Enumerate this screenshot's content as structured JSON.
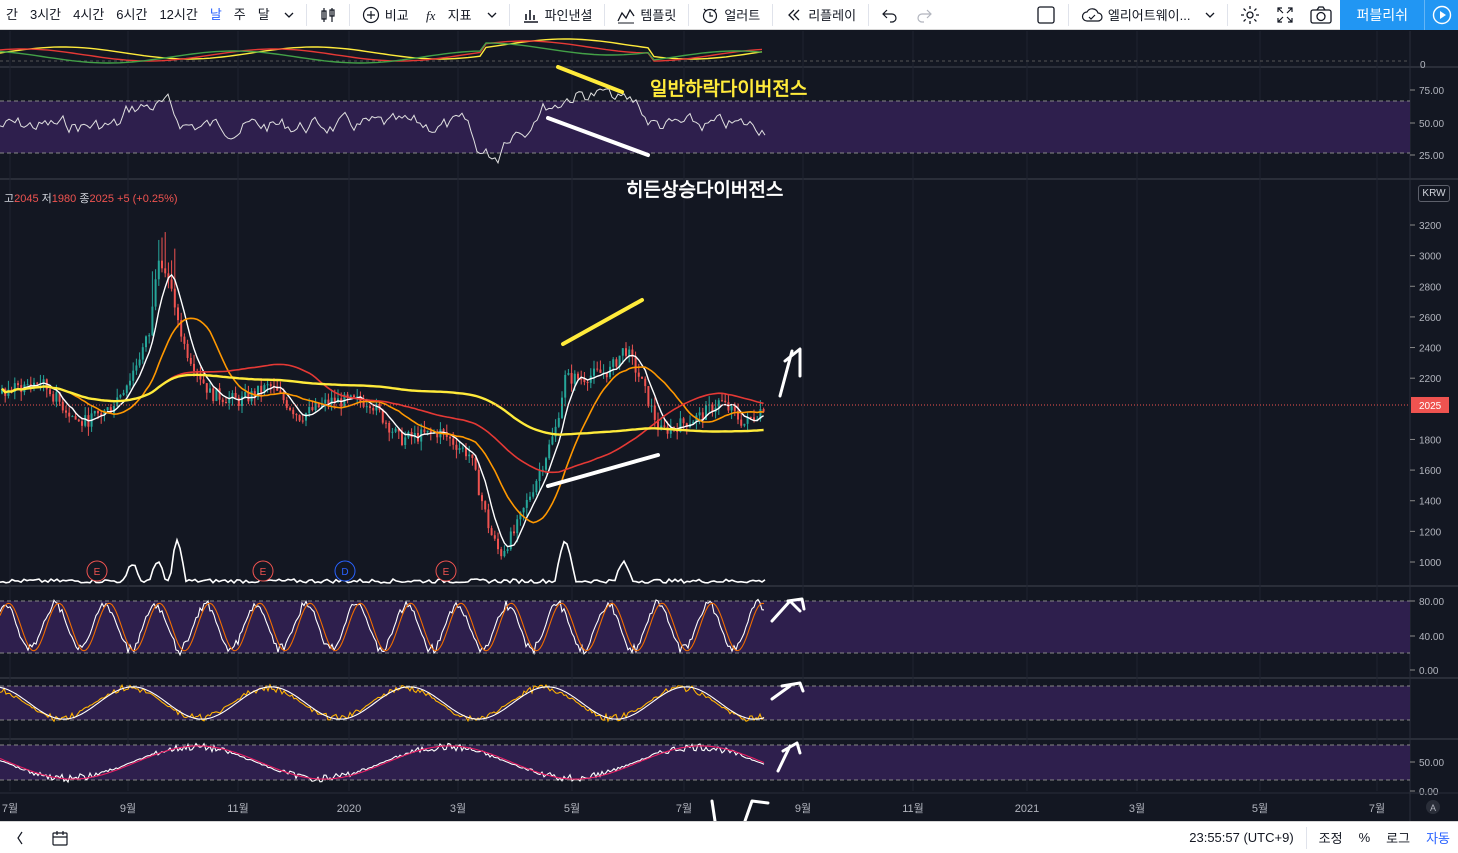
{
  "toolbar": {
    "intervals": [
      "간",
      "3시간",
      "4시간",
      "6시간",
      "12시간",
      "날",
      "주",
      "달"
    ],
    "active_interval": "날",
    "compare_label": "비교",
    "indicator_label": "지표",
    "pine_label": "파인낸셜",
    "template_label": "템플릿",
    "alert_label": "얼러트",
    "replay_label": "리플레이",
    "wave_label": "엘리어트웨이...",
    "publish_label": "퍼블리쉬"
  },
  "legend": {
    "high_label": "고",
    "high_value": "2045",
    "low_label": "저",
    "low_value": "1980",
    "close_label": "종",
    "close_value": "2025",
    "change": "+5 (+0.25%)"
  },
  "price_axis": {
    "currency": "KRW",
    "ticks": [
      "3200",
      "3000",
      "2800",
      "2600",
      "2400",
      "2200",
      "2025",
      "1800",
      "1600",
      "1400",
      "1200",
      "1000"
    ],
    "current_price": "2025"
  },
  "rsi_axis": {
    "ticks": [
      "75.00",
      "50.00",
      "25.00"
    ],
    "zero_tick": "0"
  },
  "osc1_axis": {
    "ticks": [
      "80.00",
      "40.00",
      "0.00"
    ]
  },
  "osc3_axis": {
    "ticks": [
      "50.00",
      "0.00"
    ]
  },
  "time_axis": {
    "labels": [
      "7월",
      "9월",
      "11월",
      "2020",
      "3월",
      "5월",
      "7월",
      "9월",
      "11월",
      "2021",
      "3월",
      "5월",
      "7월"
    ]
  },
  "event_markers": [
    "E",
    "E",
    "D",
    "E"
  ],
  "annotations": {
    "bearish": "일반하락다이버전스",
    "bullish": "히든상승다이버전스"
  },
  "statusbar": {
    "clock": "23:55:57 (UTC+9)",
    "adjust": "조정",
    "percent": "%",
    "log": "로그",
    "auto": "자동"
  },
  "colors": {
    "background": "#131722",
    "up": "#26a69a",
    "down": "#ef5350",
    "ma_yellow": "#ffeb3b",
    "ma_red": "#e53935",
    "ma_orange": "#ff9800",
    "oscillator_fill": "#2e1f4d",
    "publish": "#2196f3"
  }
}
